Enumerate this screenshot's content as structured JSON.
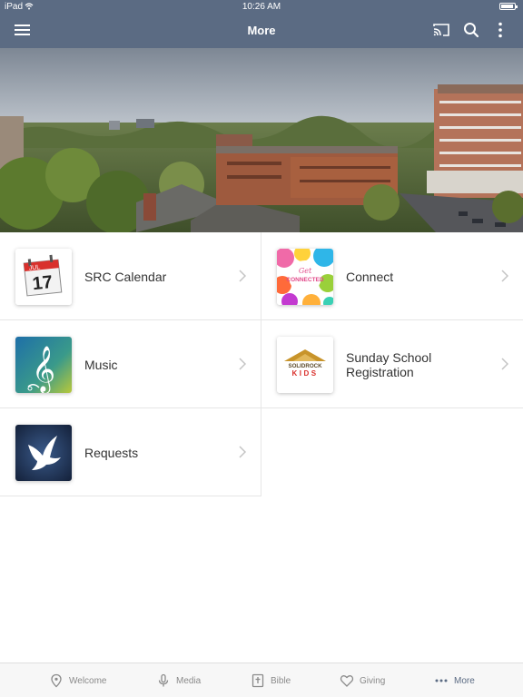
{
  "status_bar": {
    "carrier": "iPad",
    "time": "10:26 AM",
    "battery_level": 0.9
  },
  "nav": {
    "title": "More"
  },
  "items": [
    {
      "label": "SRC Calendar",
      "icon": "calendar-icon",
      "calendar_month": "JUL",
      "calendar_day": "17"
    },
    {
      "label": "Connect",
      "icon": "get-connected-icon",
      "thumb_text_1": "Get",
      "thumb_text_2": "CONNECTED"
    },
    {
      "label": "Music",
      "icon": "treble-clef-icon"
    },
    {
      "label": "Sunday School Registration",
      "icon": "solid-rock-kids-icon",
      "thumb_text_1": "SOLIDROCK",
      "thumb_text_2": "KIDS"
    },
    {
      "label": "Requests",
      "icon": "dove-icon"
    }
  ],
  "tabs": [
    {
      "label": "Welcome",
      "icon": "map-pin-icon"
    },
    {
      "label": "Media",
      "icon": "microphone-icon"
    },
    {
      "label": "Bible",
      "icon": "bible-icon"
    },
    {
      "label": "Giving",
      "icon": "heart-icon"
    },
    {
      "label": "More",
      "icon": "more-dots-icon",
      "active": true
    }
  ],
  "colors": {
    "header": "#5b6b83",
    "tab_active": "#5b6b83",
    "tab_inactive": "#8a8a8a"
  }
}
